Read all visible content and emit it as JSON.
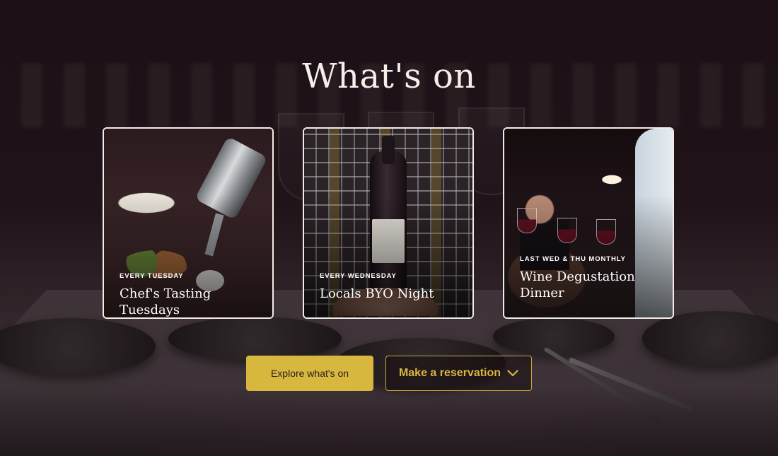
{
  "section": {
    "title": "What's on"
  },
  "events": [
    {
      "frequency": "EVERY TUESDAY",
      "name": "Chef's Tasting Tuesdays",
      "image": "chef-plating-photo"
    },
    {
      "frequency": "EVERY WEDNESDAY",
      "name": "Locals BYO Night",
      "image": "wine-rack-bottle-photo"
    },
    {
      "frequency": "LAST WED & THU MONTHLY",
      "name": "Wine Degustation Dinner",
      "image": "wine-toast-photo"
    }
  ],
  "actions": {
    "explore_label": "Explore what's on",
    "reserve_label": "Make a reservation",
    "reserve_icon": "chevron-down-icon"
  },
  "colors": {
    "accent_gold": "#d8b73f",
    "card_border": "#f3ece6",
    "background": "#1c1116"
  }
}
